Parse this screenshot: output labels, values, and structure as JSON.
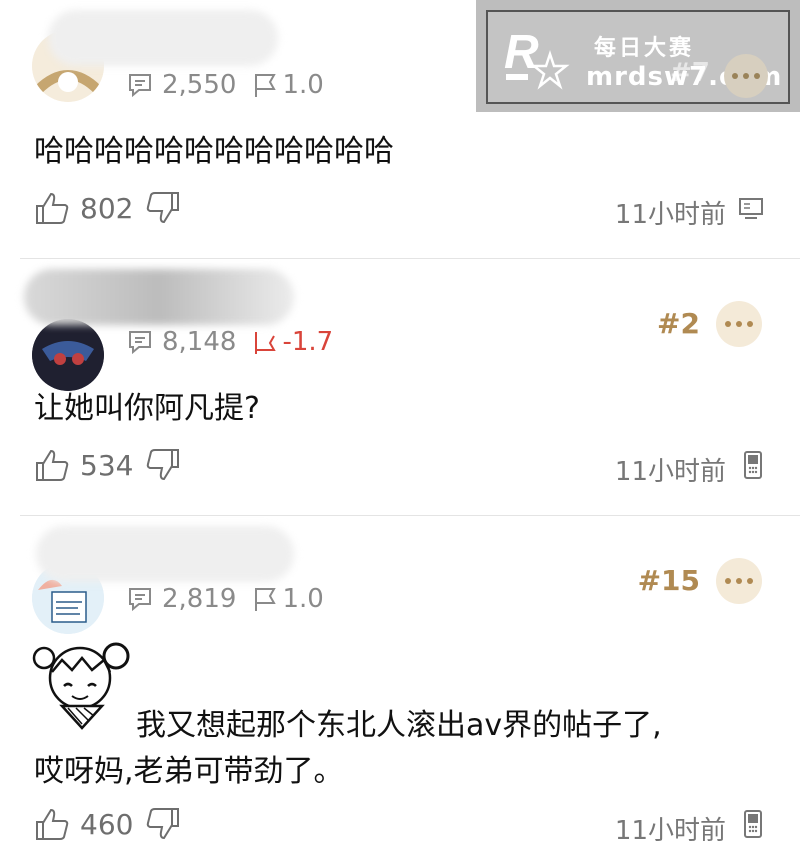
{
  "comments": [
    {
      "reply_count": "2,550",
      "flag_score": "1.0",
      "flag_color": "#8a8a8a",
      "rank": "#7",
      "body": "哈哈哈哈哈哈哈哈哈哈哈哈",
      "likes": "802",
      "time": "11小时前",
      "device_icon": "desktop-icon"
    },
    {
      "reply_count": "8,148",
      "flag_score": "-1.7",
      "flag_color": "#d9443a",
      "rank": "#2",
      "body": "让她叫你阿凡提?",
      "likes": "534",
      "time": "11小时前",
      "device_icon": "phone-icon"
    },
    {
      "reply_count": "2,819",
      "flag_score": "1.0",
      "flag_color": "#8a8a8a",
      "rank": "#15",
      "body_line1": "我又想起那个东北人滚出av界的帖子了,",
      "body_line2": "哎呀妈,老弟可带劲了。",
      "likes": "460",
      "time": "11小时前",
      "device_icon": "phone-icon"
    }
  ],
  "watermark": {
    "line1": "每日大赛",
    "line2": "mrdsw7.com"
  },
  "colors": {
    "accent": "#b08a52",
    "negative": "#d9443a",
    "muted": "#8a8a8a"
  }
}
